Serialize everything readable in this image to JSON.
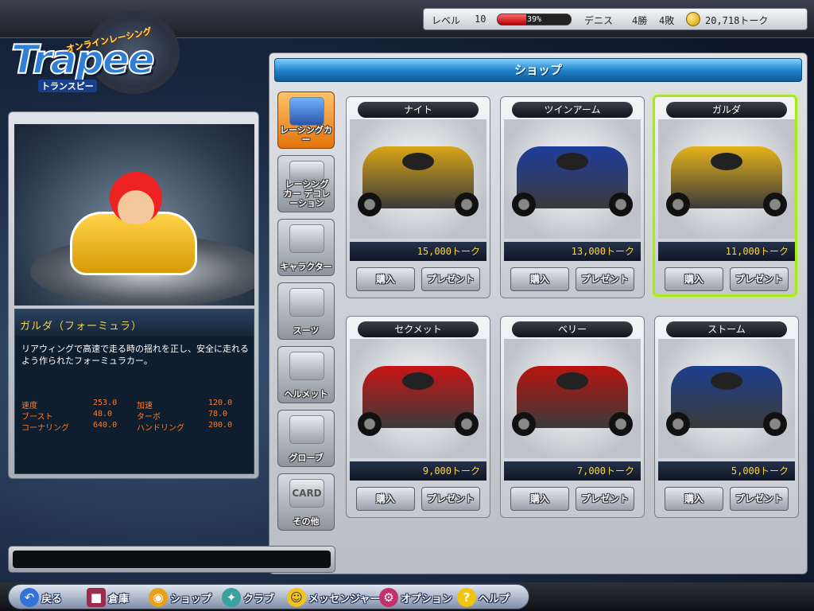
{
  "status": {
    "level_label": "レベル",
    "level": "10",
    "xp_percent": 39,
    "xp_text": "39%",
    "rank_label": "デニス",
    "wins": "4勝",
    "losses": "4敗",
    "currency": "20,718トーク"
  },
  "logo": {
    "wordmark": "Trapee",
    "sub_top": "オンラインレーシング",
    "sub_bottom": "トランスピー"
  },
  "detail": {
    "name": "ガルダ（フォーミュラ）",
    "description": "リアウィングで高速で走る時の揺れを正し、安全に走れるよう作られたフォーミュラカー。",
    "stats": [
      {
        "label_a": "速度",
        "value_a": "253.0",
        "label_b": "加速",
        "value_b": "120.0"
      },
      {
        "label_a": "ブースト",
        "value_a": "48.0",
        "label_b": "ターボ",
        "value_b": "78.0"
      },
      {
        "label_a": "コーナリング",
        "value_a": "640.0",
        "label_b": "ハンドリング",
        "value_b": "200.0"
      }
    ]
  },
  "shop": {
    "title": "ショップ",
    "categories": [
      {
        "label": "レーシングカー",
        "active": true
      },
      {
        "label": "レーシングカー デコレーション",
        "active": false
      },
      {
        "label": "キャラクター",
        "active": false
      },
      {
        "label": "スーツ",
        "active": false
      },
      {
        "label": "ヘルメット",
        "active": false
      },
      {
        "label": "グローブ",
        "active": false
      },
      {
        "label": "その他",
        "active": false,
        "badge": "CARD"
      }
    ],
    "buy_label": "購入",
    "gift_label": "プレゼント",
    "items": [
      {
        "name": "ナイト",
        "price": "15,000トーク",
        "color": "#d9a516",
        "selected": false
      },
      {
        "name": "ツインアーム",
        "price": "13,000トーク",
        "color": "#1f3d9c",
        "selected": false
      },
      {
        "name": "ガルダ",
        "price": "11,000トーク",
        "color": "#e5b21a",
        "selected": true
      },
      {
        "name": "セクメット",
        "price": "9,000トーク",
        "color": "#c81414",
        "selected": false
      },
      {
        "name": "ベリー",
        "price": "7,000トーク",
        "color": "#b8140f",
        "selected": false
      },
      {
        "name": "ストーム",
        "price": "5,000トーク",
        "color": "#1d3f8f",
        "selected": false
      }
    ]
  },
  "nav": [
    {
      "label": "戻る",
      "icon": "back-arrow-icon"
    },
    {
      "label": "倉庫",
      "icon": "storage-box-icon"
    },
    {
      "label": "ショップ",
      "icon": "shop-icon"
    },
    {
      "label": "クラブ",
      "icon": "club-icon"
    },
    {
      "label": "メッセンジャー",
      "icon": "messenger-icon"
    },
    {
      "label": "オプション",
      "icon": "options-gear-icon"
    },
    {
      "label": "ヘルプ",
      "icon": "help-icon"
    }
  ],
  "colors": {
    "accent_blue": "#1d7fc9",
    "price_yellow": "#ffd33a",
    "stat_orange": "#ff7a2a",
    "name_gold": "#f2d25a",
    "selected_green": "#a9e81b",
    "active_tab_orange": "#e2730b"
  }
}
